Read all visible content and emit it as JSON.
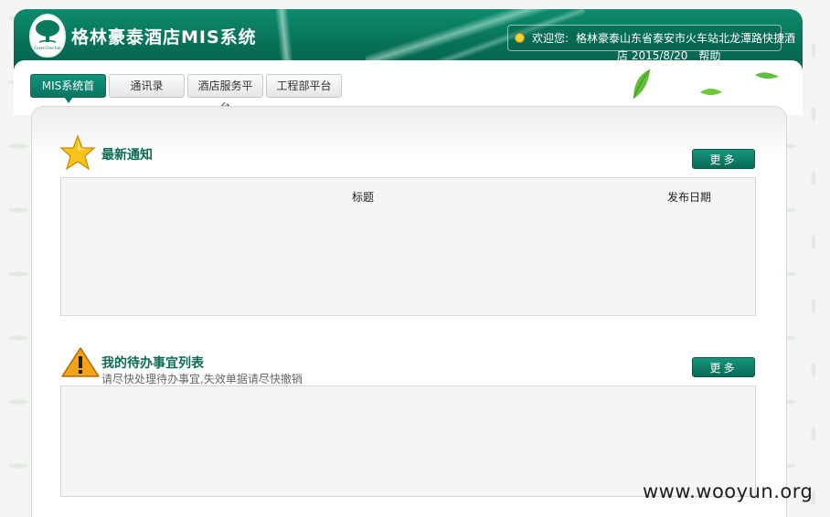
{
  "header": {
    "app_title": "格林豪泰酒店MIS系统",
    "logo_text": "GreenTree Inn",
    "welcome": "欢迎您:",
    "hotel_line1": "格林豪泰山东省泰安市火车站北龙潭路快捷酒",
    "hotel_line2": "店 2015/8/20",
    "help": "帮助"
  },
  "tabs": [
    {
      "label": "MIS系统首页",
      "active": true
    },
    {
      "label": "通讯录",
      "active": false
    },
    {
      "label": "酒店服务平台",
      "active": false
    },
    {
      "label": "工程部平台",
      "active": false
    }
  ],
  "notices": {
    "title": "最新通知",
    "more": "更多",
    "columns": [
      "标题",
      "发布日期"
    ]
  },
  "todo": {
    "title": "我的待办事宜列表",
    "subtitle": "请尽快处理待办事宜,失效单据请尽快撤销",
    "more": "更多"
  },
  "watermark": "www.wooyun.org",
  "colors": {
    "brand_green": "#077159",
    "title_green": "#0d6b55",
    "button_green": "#0f8a71"
  }
}
